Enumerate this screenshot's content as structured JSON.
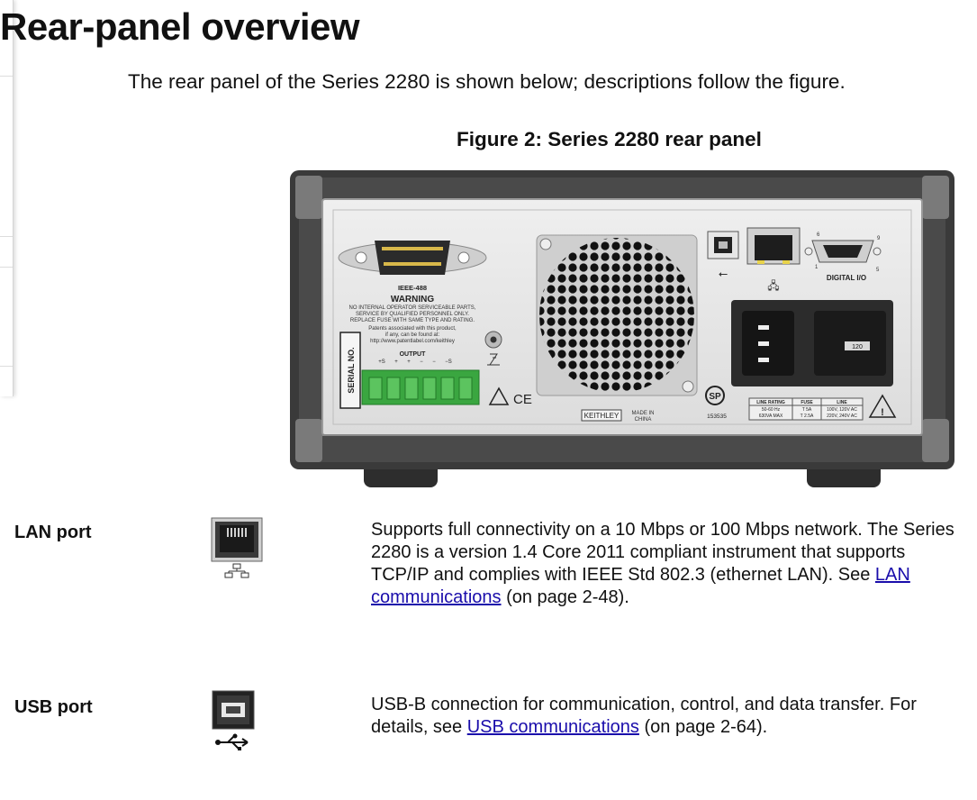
{
  "page": {
    "title": "Rear-panel overview",
    "intro": "The rear panel of the Series 2280 is shown below; descriptions follow the figure.",
    "figure_caption": "Figure 2: Series 2280 rear panel"
  },
  "panel_labels": {
    "ieee": "IEEE-488",
    "warning_title": "WARNING",
    "warning_lines": [
      "NO INTERNAL OPERATOR SERVICEABLE PARTS,",
      "SERVICE BY QUALIFIED PERSONNEL ONLY.",
      "REPLACE FUSE WITH SAME TYPE AND RATING.",
      "Patents associated with this product,",
      "if any, can be found at:",
      "http://www.patentlabel.com/keithley"
    ],
    "output": "OUTPUT",
    "output_terminals": [
      "+S",
      "+",
      "+",
      "−",
      "−",
      "−S"
    ],
    "serial": "SERIAL NO.",
    "ce": "CE",
    "keithley": "KEITHLEY",
    "made_in_1": "MADE IN",
    "made_in_2": "CHINA",
    "cert_number": "153535",
    "digital_io": "DIGITAL I/O",
    "db9_pin_1": "1",
    "db9_pin_5": "5",
    "db9_pin_6": "6",
    "db9_pin_9": "9",
    "fuse_value": "120",
    "rating_headers": [
      "LINE RATING",
      "FUSE",
      "LINE"
    ],
    "rating_row1": [
      "50-60 Hz",
      "T 5A",
      "100V, 120V AC"
    ],
    "rating_row2": [
      "630VA MAX",
      "T 2.5A",
      "220V, 240V AC"
    ]
  },
  "rows": [
    {
      "title": "LAN port",
      "icon": "ethernet-port-icon",
      "desc_text": "Supports full connectivity on a 10 Mbps or 100 Mbps network. The Series 2280 is a version 1.4 Core 2011 compliant instrument that supports TCP/IP and complies with IEEE Std 802.3 (ethernet LAN). See ",
      "link": "LAN communications",
      "desc_after": " (on page 2-48)."
    },
    {
      "title": "USB port",
      "icon": "usb-port-icon",
      "desc_text": "USB-B connection for communication, control, and data transfer. For details, see ",
      "link": "USB communications",
      "desc_after": " (on page 2-64)."
    }
  ]
}
